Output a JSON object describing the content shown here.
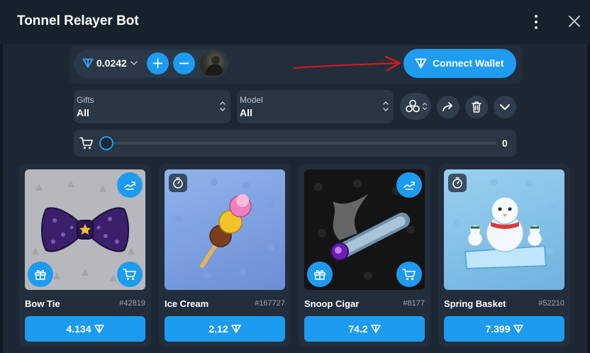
{
  "window": {
    "title": "Tonnel Relayer Bot",
    "icons": [
      "more-vertical-icon",
      "close-icon"
    ]
  },
  "wallet": {
    "balance": "0.0242",
    "plus_label": "+",
    "minus_label": "−",
    "connect_label": "Connect Wallet"
  },
  "filters": {
    "gifts": {
      "label": "Gifts",
      "value": "All"
    },
    "model": {
      "label": "Model",
      "value": "All"
    }
  },
  "cart": {
    "count": "0",
    "slider_fraction": 0
  },
  "colors": {
    "accent": "#1d9bf0",
    "background": "#17212b",
    "panel": "#1c2733",
    "card": "#222e3b",
    "annotation_arrow": "#d8161b"
  },
  "items": [
    {
      "name": "Bow Tie",
      "id": "#42819",
      "price": "4.134",
      "badge": "transfer-icon",
      "has_timer": false
    },
    {
      "name": "Ice Cream",
      "id": "#167727",
      "price": "2.12",
      "badge": "",
      "has_timer": true
    },
    {
      "name": "Snoop Cigar",
      "id": "#8177",
      "price": "74.2",
      "badge": "transfer-icon",
      "has_timer": false
    },
    {
      "name": "Spring Basket",
      "id": "#52210",
      "price": "7.399",
      "badge": "",
      "has_timer": true
    }
  ]
}
